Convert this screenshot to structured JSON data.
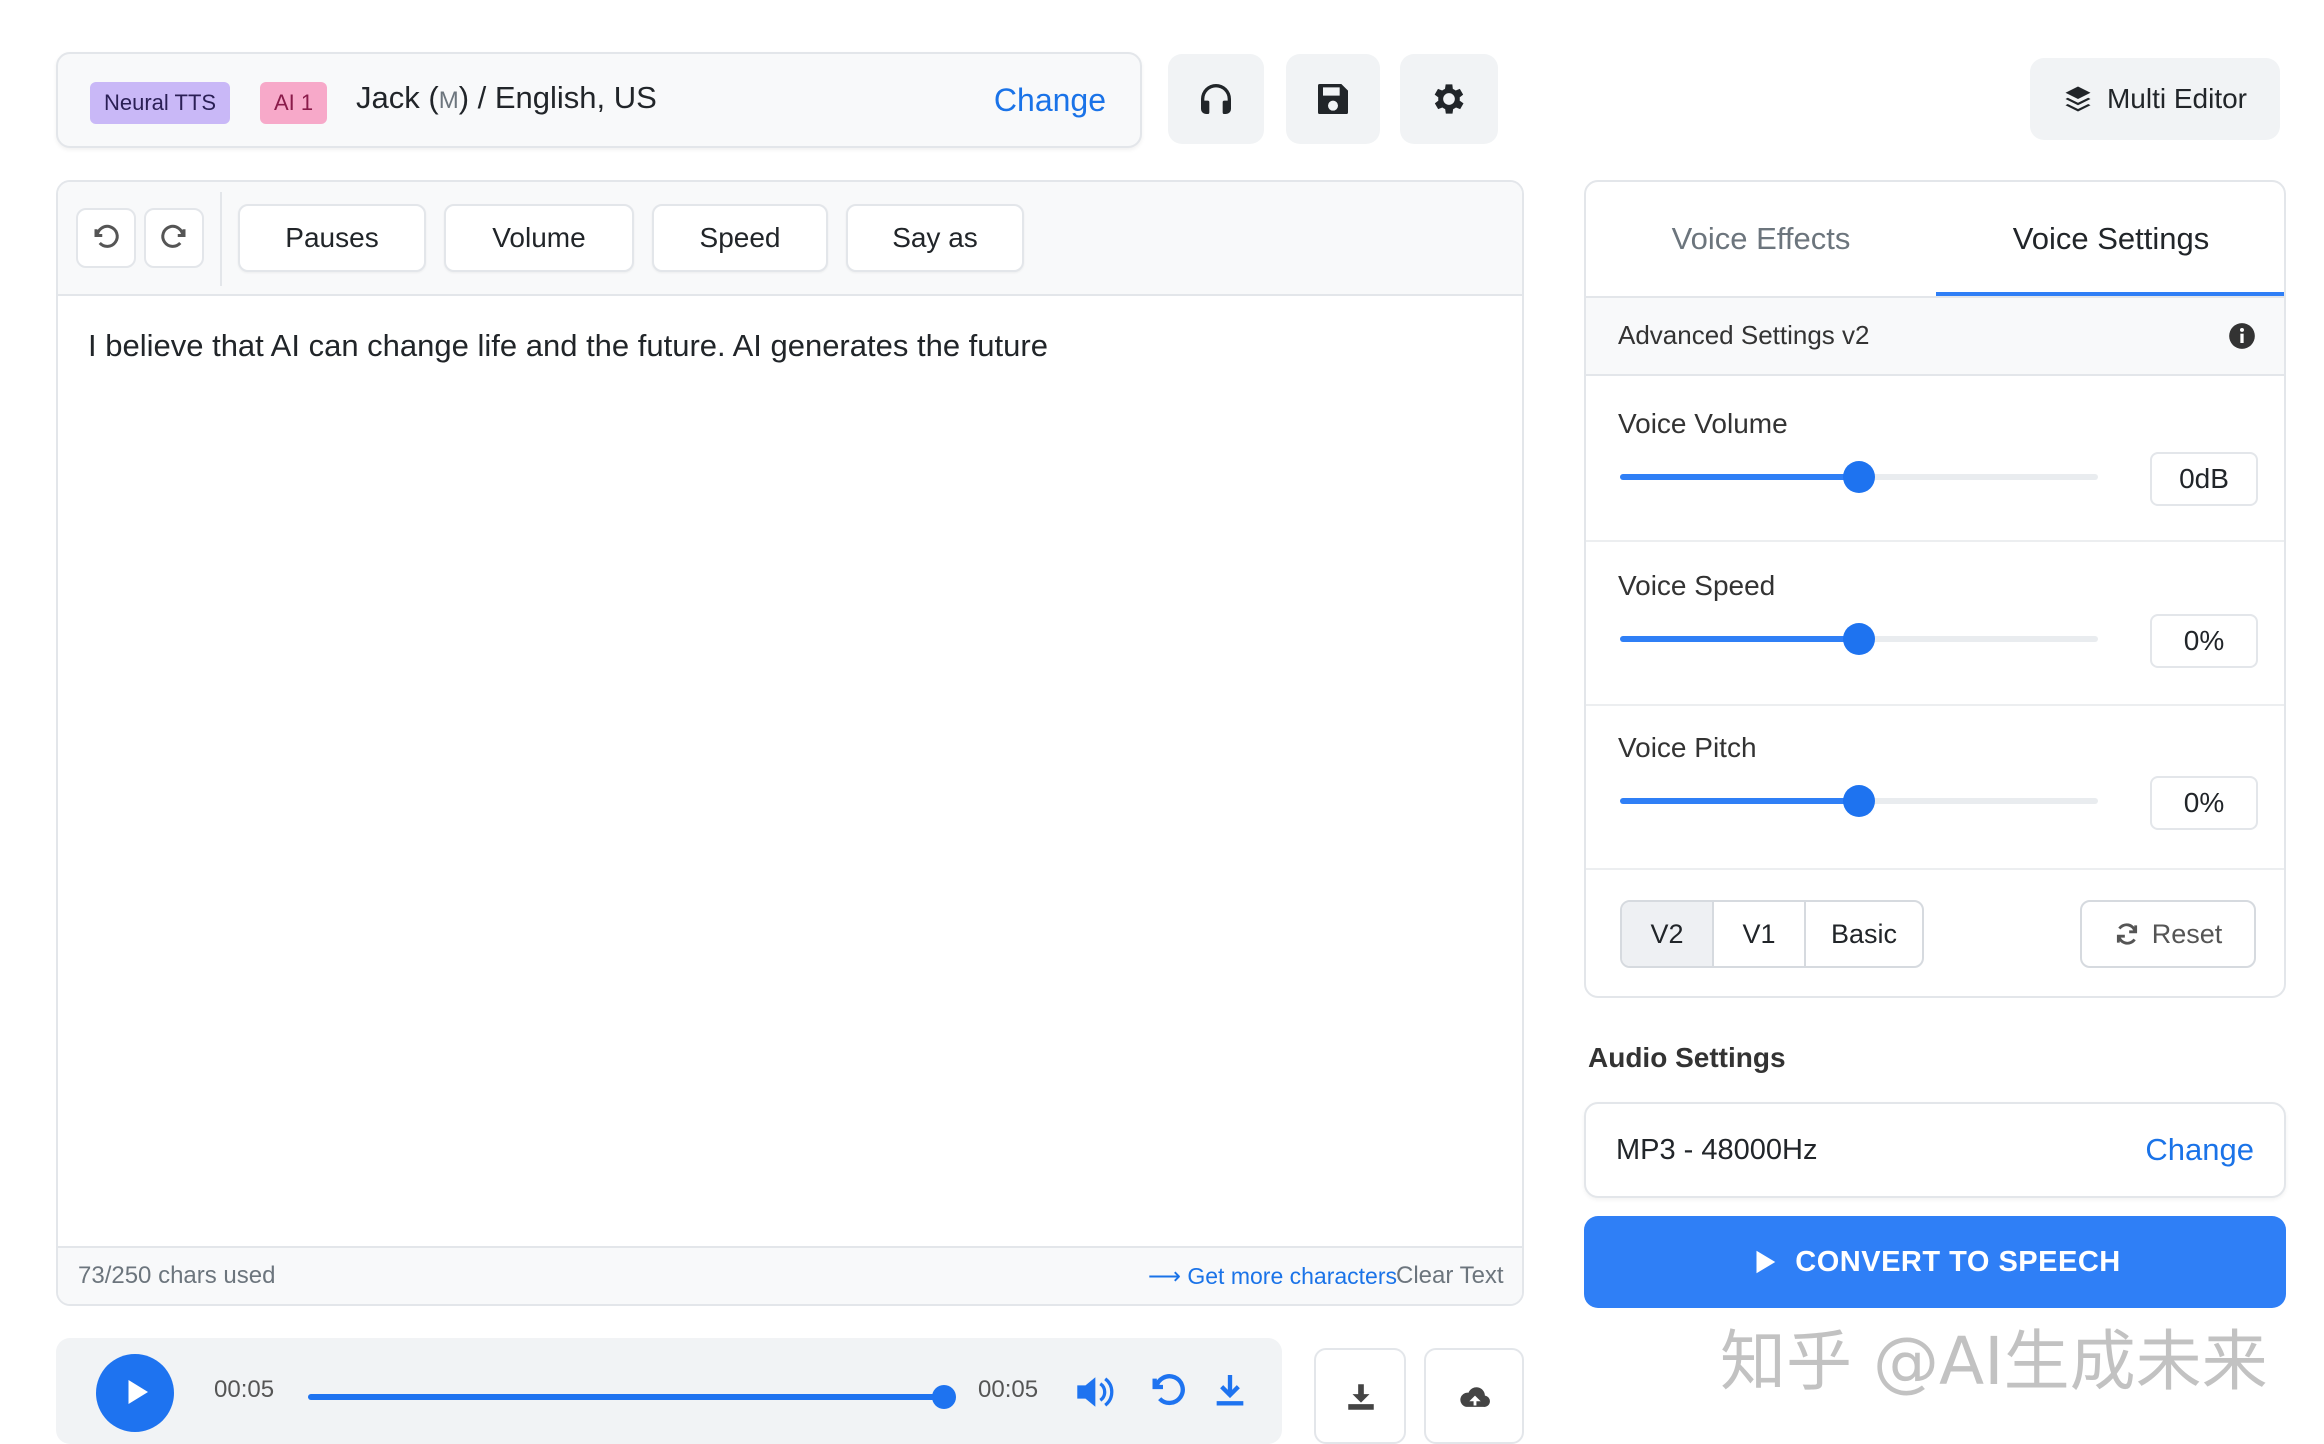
{
  "voice_bar": {
    "badge_engine": "Neural TTS",
    "badge_ai": "AI 1",
    "voice_name": "Jack (",
    "voice_gender": "M",
    "voice_rest": ") / English, US",
    "change_label": "Change"
  },
  "top_icons": [
    "headphones-icon",
    "save-icon",
    "gear-icon"
  ],
  "multi_editor": {
    "label": "Multi Editor"
  },
  "editor": {
    "tools": [
      "Pauses",
      "Volume",
      "Speed",
      "Say as"
    ],
    "text": "I believe that AI can change life and the future. AI generates the future",
    "chars_used": "73/250 chars used",
    "get_more": "Get more characters",
    "clear_text": "Clear Text"
  },
  "player": {
    "time_current": "00:05",
    "time_total": "00:05",
    "progress": 1.0
  },
  "settings_panel": {
    "tabs": [
      "Voice Effects",
      "Voice Settings"
    ],
    "active_tab": "Voice Settings",
    "section_title": "Advanced Settings v2",
    "sliders": [
      {
        "label": "Voice Volume",
        "value": "0dB",
        "level": 0.5
      },
      {
        "label": "Voice Speed",
        "value": "0%",
        "level": 0.5
      },
      {
        "label": "Voice Pitch",
        "value": "0%",
        "level": 0.5
      }
    ],
    "versions": [
      "V2",
      "V1",
      "Basic"
    ],
    "active_version": "V2",
    "reset_label": "Reset"
  },
  "audio_settings": {
    "title": "Audio Settings",
    "format": "MP3 - 48000Hz",
    "change_label": "Change"
  },
  "convert_button": {
    "label": "CONVERT TO SPEECH"
  },
  "watermark": "知乎 @AI生成未来",
  "colors": {
    "accent": "#2f7ff6",
    "badge_engine_bg": "#c9b8f7",
    "badge_ai_bg": "#f7a9c9",
    "link": "#1a73e8"
  }
}
